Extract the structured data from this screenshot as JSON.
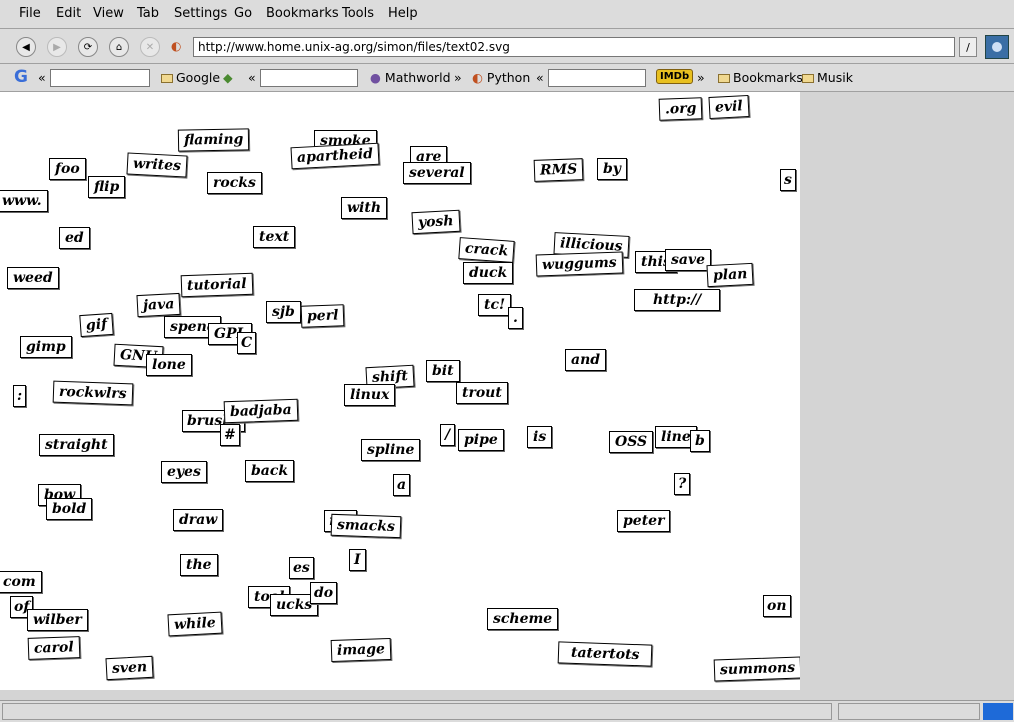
{
  "menu": [
    "File",
    "Edit",
    "View",
    "Tab",
    "Settings",
    "Go",
    "Bookmarks",
    "Tools",
    "Help"
  ],
  "url": "http://www.home.unix-ag.org/simon/files/text02.svg",
  "toolbar": {
    "search_chevron": "«",
    "google_label": "Google",
    "mathworld_label": "Mathworld",
    "python_label": "Python",
    "imdb_label": "IMDb",
    "bookmarks_label": "Bookmarks",
    "musik_label": "Musik",
    "more_chevron": "»"
  },
  "colors": {
    "accent": "#3a6ea5",
    "status_progress": "#1e6ad8"
  },
  "svg_words": [
    ".org",
    "evil",
    "flaming",
    "smoke",
    "apartheid",
    "are",
    "several",
    "RMS",
    "by",
    "s",
    "foo",
    "writes",
    "flip",
    "rocks",
    "www.",
    "with",
    "yosh",
    "ed",
    "text",
    "crack",
    "illicious",
    "duck",
    "wuggums",
    "this",
    "save",
    "plan",
    "weed",
    "tutorial",
    "http://",
    "java",
    "sjb",
    "perl",
    "tc!",
    ".",
    "gif",
    "spenc",
    "GPL",
    "C",
    "gimp",
    "GNU",
    "lone",
    "and",
    "shift",
    "bit",
    ":",
    "rockwlrs",
    "linux",
    "trout",
    "brush",
    "badjaba",
    "#",
    "straight",
    "/",
    "pipe",
    "is",
    "OSS",
    "line",
    "b",
    "spline",
    "eyes",
    "back",
    "a",
    "?",
    "bow",
    "bold",
    "draw",
    "r",
    "smacks",
    "peter",
    "the",
    "es",
    "I",
    "com",
    "tool",
    "ucks",
    "do",
    "on",
    "of",
    "wilber",
    "while",
    "scheme",
    "carol",
    "image",
    "tatertots",
    "sven",
    "summons"
  ]
}
